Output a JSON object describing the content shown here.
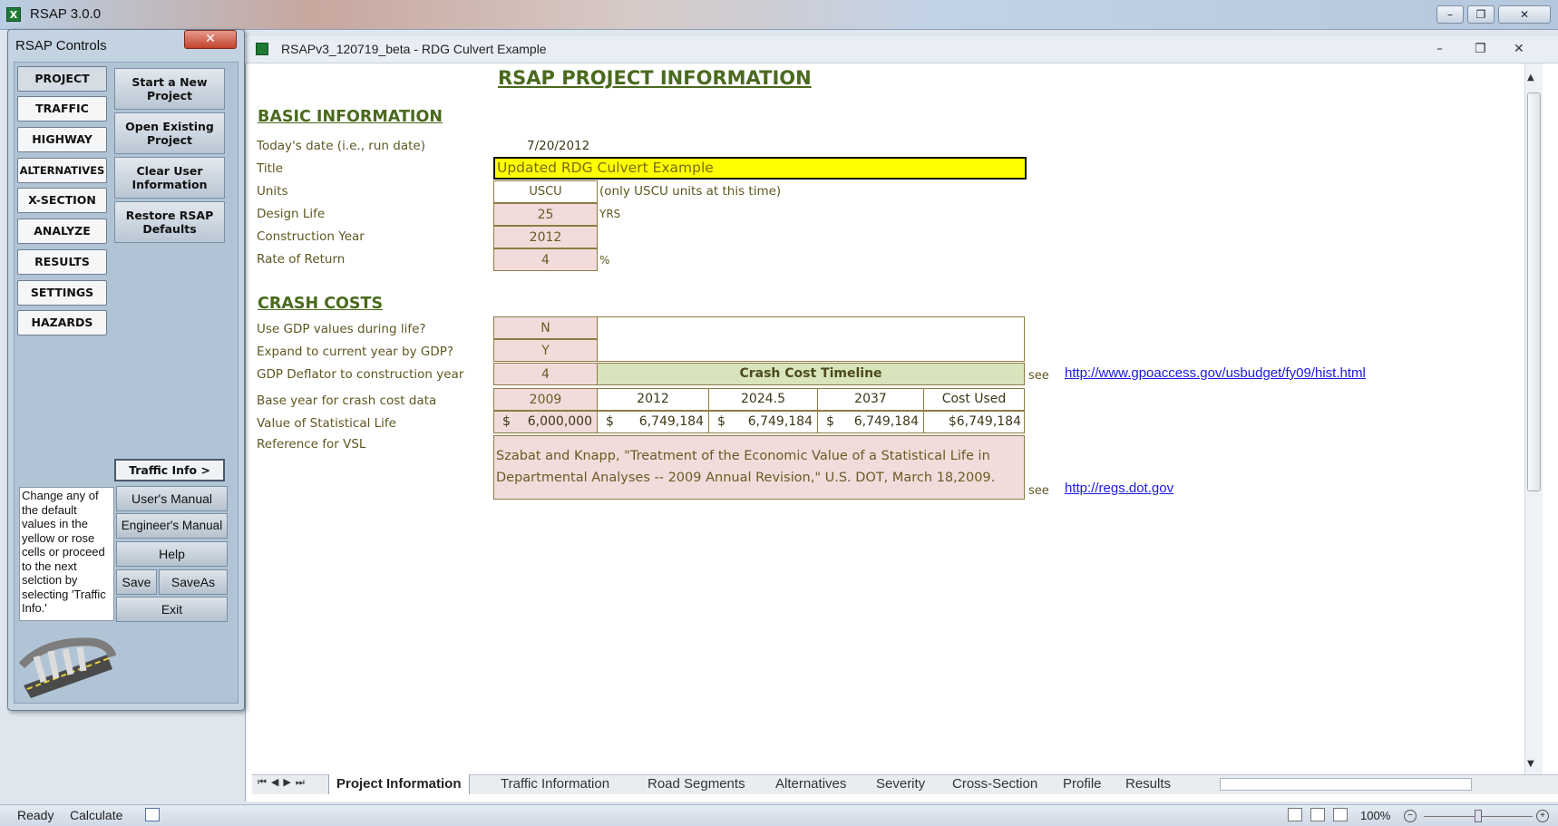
{
  "app": {
    "title": "RSAP 3.0.0"
  },
  "window_buttons": {
    "minimize": "–",
    "restore": "❐",
    "close": "✕"
  },
  "document": {
    "title": "RSAPv3_120719_beta - RDG Culvert Example"
  },
  "sheet": {
    "title": "RSAP PROJECT INFORMATION",
    "basic": {
      "heading": "BASIC INFORMATION",
      "date_label": "Today's date (i.e., run date)",
      "date_value": "7/20/2012",
      "title_label": "Title",
      "title_value": "Updated RDG Culvert Example",
      "units_label": "Units",
      "units_value": "USCU",
      "units_note": "(only USCU units at this time)",
      "design_life_label": "Design Life",
      "design_life_value": "25",
      "design_life_unit": "YRS",
      "construction_year_label": "Construction Year",
      "construction_year_value": "2012",
      "rate_label": "Rate of Return",
      "rate_value": "4",
      "rate_unit": "%"
    },
    "crash": {
      "heading": "CRASH COSTS",
      "gdp_life_label": "Use GDP values during life?",
      "gdp_life_value": "N",
      "expand_label": "Expand to current year by GDP?",
      "expand_value": "Y",
      "deflator_label": "GDP Deflator to construction year",
      "deflator_value": "4",
      "timeline_header": "Crash Cost Timeline",
      "see": "see",
      "link1": "http://www.gpoaccess.gov/usbudget/fy09/hist.html",
      "base_year_label": "Base year for crash cost data",
      "base_year_value": "2009",
      "years": [
        "2012",
        "2024.5",
        "2037",
        "Cost Used"
      ],
      "vsl_label": "Value of Statistical Life",
      "vsl_base_sym": "$",
      "vsl_base_val": "6,000,000",
      "vsl_values": [
        {
          "sym": "$",
          "val": "6,749,184"
        },
        {
          "sym": "$",
          "val": "6,749,184"
        },
        {
          "sym": "$",
          "val": "6,749,184"
        },
        {
          "sym": "",
          "val": "$6,749,184"
        }
      ],
      "ref_label": "Reference for VSL",
      "ref_text": "Szabat and Knapp, \"Treatment of the Economic Value of a Statistical Life in Departmental Analyses -- 2009 Annual Revision,\" U.S. DOT, March 18,2009.",
      "link2": "http://regs.dot.gov"
    }
  },
  "tabs": [
    "Project Information",
    "Traffic Information",
    "Road Segments",
    "Alternatives",
    "Severity",
    "Cross-Section",
    "Profile",
    "Results"
  ],
  "status": {
    "ready": "Ready",
    "calculate": "Calculate",
    "zoom": "100%"
  },
  "controls": {
    "title": "RSAP Controls",
    "nav": [
      "PROJECT",
      "TRAFFIC",
      "HIGHWAY",
      "ALTERNATIVES",
      "X-SECTION",
      "ANALYZE",
      "RESULTS",
      "SETTINGS",
      "HAZARDS"
    ],
    "actions": [
      "Start a New Project",
      "Open Existing Project",
      "Clear User Information",
      "Restore RSAP Defaults"
    ],
    "traffic_info": "Traffic Info  >",
    "note": "Change any of the default values in the yellow or rose cells or proceed to the next selction by selecting 'Traffic Info.'",
    "users_manual": "User's Manual",
    "engineers_manual": "Engineer's Manual",
    "help": "Help",
    "save": "Save",
    "saveas": "SaveAs",
    "exit": "Exit"
  },
  "colors": {
    "title_cell": "#ffff00",
    "input_cell": "#f2dcdb",
    "timeline_header": "#d7e4bc",
    "heading": "#4a6a1e"
  }
}
